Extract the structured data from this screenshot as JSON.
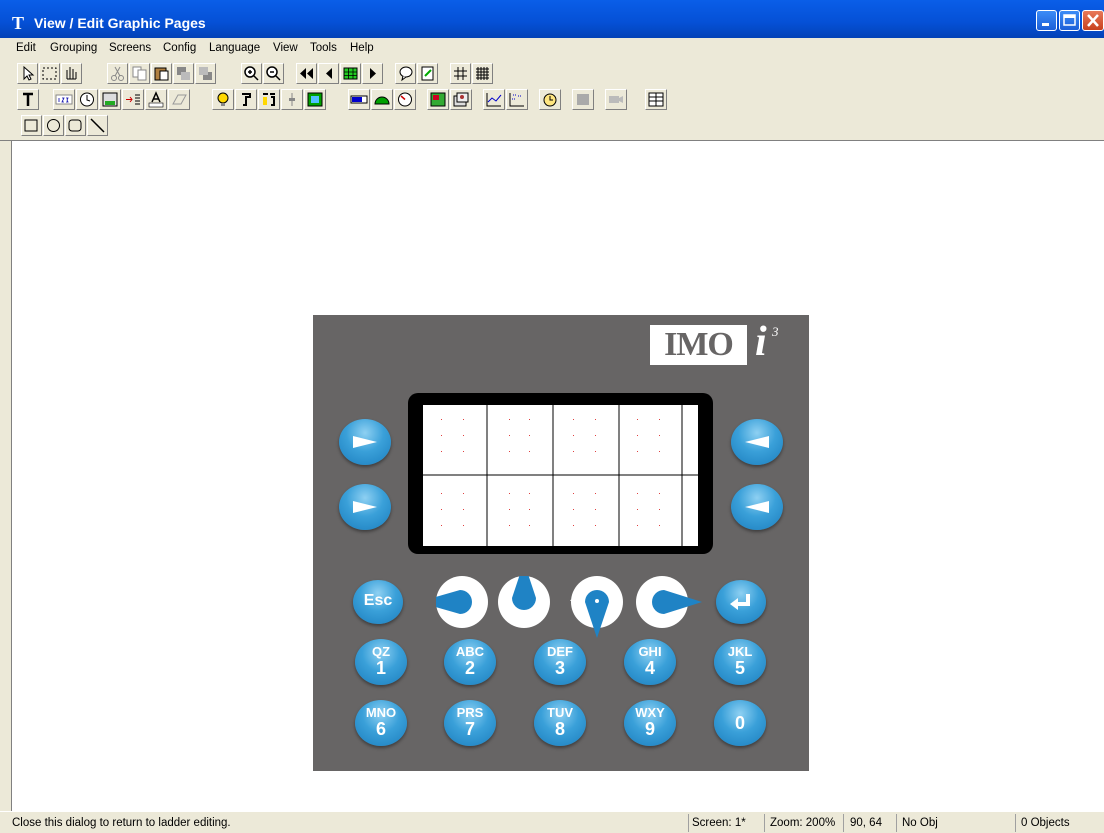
{
  "window": {
    "title": "View / Edit Graphic Pages",
    "title_icon": "T",
    "controls": [
      "minimize-icon",
      "maximize-icon",
      "close-icon"
    ]
  },
  "menu": [
    "Edit",
    "Grouping",
    "Screens",
    "Config",
    "Language",
    "View",
    "Tools",
    "Help"
  ],
  "toolbar_rows": {
    "row1": [
      "pointer-icon",
      "select-rect-icon",
      "hand-icon",
      "cut-icon",
      "copy-icon",
      "paste-icon",
      "bring-front-icon",
      "send-back-icon",
      "zoom-in-icon",
      "zoom-out-icon",
      "first-page-icon",
      "prev-page-icon",
      "page-grid-icon",
      "next-page-icon",
      "comment-icon",
      "edit-page-icon",
      "grid-icon",
      "fine-grid-icon"
    ],
    "row2": [
      "text-icon",
      "numeric-icon",
      "clock-icon",
      "password-icon",
      "list-icon",
      "text-box-icon",
      "eraser-icon",
      "bulb-icon",
      "switch-icon",
      "multi-switch-icon",
      "slider-icon",
      "bitmap-icon",
      "bar-icon",
      "gauge-icon",
      "dial-icon",
      "picture-icon",
      "animation-icon",
      "trend-icon",
      "xy-chart-icon",
      "timer-icon",
      "disabled-box-icon",
      "camera-icon",
      "table-icon"
    ],
    "row3": [
      "rectangle-icon",
      "circle-icon",
      "rounded-rect-icon",
      "line-icon"
    ]
  },
  "panel": {
    "logo_text": "IMO",
    "logo_i": "i",
    "logo_sup": "3",
    "keys": {
      "esc": "Esc",
      "plusminus": "+/-",
      "k1": {
        "top": "QZ",
        "bottom": "1"
      },
      "k2": {
        "top": "ABC",
        "bottom": "2"
      },
      "k3": {
        "top": "DEF",
        "bottom": "3"
      },
      "k4": {
        "top": "GHI",
        "bottom": "4"
      },
      "k5": {
        "top": "JKL",
        "bottom": "5"
      },
      "k6": {
        "top": "MNO",
        "bottom": "6"
      },
      "k7": {
        "top": "PRS",
        "bottom": "7"
      },
      "k8": {
        "top": "TUV",
        "bottom": "8"
      },
      "k9": {
        "top": "WXY",
        "bottom": "9"
      },
      "k0": {
        "top": "",
        "bottom": "0"
      }
    }
  },
  "status": {
    "message": "Close this dialog to return to ladder editing.",
    "screen": "Screen: 1*",
    "zoom": "Zoom: 200%",
    "coords": "90, 64",
    "object": "No Obj",
    "count": "0 Objects"
  }
}
